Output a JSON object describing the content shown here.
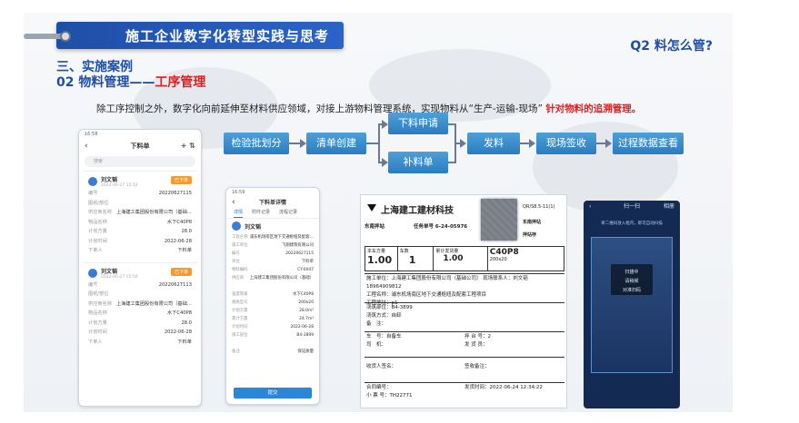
{
  "header": {
    "title": "施工企业数字化转型实践与思考",
    "question": "Q2 料怎么管?"
  },
  "section": {
    "line1": "三、实施案例",
    "line2_prefix": "02 物料管理——",
    "line2_highlight": "工序管理"
  },
  "intro": {
    "text": "除工序控制之外，数字化向前延伸至材料供应领域，对接上游物料管理系统，实现物料从“生产-运输-现场”",
    "highlight": "针对物料的追溯管理。"
  },
  "flow": {
    "steps": [
      "检验批划分",
      "清单创建",
      "下料申请",
      "补料单",
      "发料",
      "现场签收",
      "过程数据查看"
    ]
  },
  "phone1": {
    "status": "16:58",
    "title": "下料单",
    "search_placeholder": "搜索",
    "cards": [
      {
        "name": "刘文韬",
        "time": "2022-06-27 15:52",
        "badge": "已下单",
        "rows": [
          {
            "k": "编号",
            "v": "20220627115"
          },
          {
            "k": "图纸/部位",
            "v": ""
          },
          {
            "k": "供应商名称",
            "v": "上海建工集团股份有限公司（基础…"
          },
          {
            "k": "物品名称",
            "v": "水下C40P8"
          },
          {
            "k": "计划方量",
            "v": "28.0"
          },
          {
            "k": "计划时间",
            "v": "2022-06-28"
          },
          {
            "k": "下单人",
            "v": "下料单"
          }
        ]
      },
      {
        "name": "刘文韬",
        "time": "2022-06-27 15:50",
        "badge": "已下单",
        "rows": [
          {
            "k": "编号",
            "v": "20220627113"
          },
          {
            "k": "图纸/部位",
            "v": ""
          },
          {
            "k": "供应商名称",
            "v": "上海建工集团股份有限公司（基础…"
          },
          {
            "k": "物品名称",
            "v": "水下C40P8"
          },
          {
            "k": "计划方量",
            "v": "28.0"
          },
          {
            "k": "计划时间",
            "v": "2022-06-28"
          },
          {
            "k": "下单人",
            "v": "下料单"
          }
        ]
      }
    ]
  },
  "phone2": {
    "status": "16:59",
    "title": "下料单详情",
    "tabs": [
      "详情",
      "附件记录",
      "流程记录"
    ],
    "user": "刘文韬",
    "rows": [
      {
        "k": "工程名称",
        "v": "浦东机场南区地下交通枢纽及配套…"
      },
      {
        "k": "施工单位",
        "v": "飞翔建筑有限公司"
      },
      {
        "k": "编号",
        "v": "20220627115"
      },
      {
        "k": "单位",
        "v": "下料单"
      },
      {
        "k": "物料编码",
        "v": "CY-0047"
      },
      {
        "k": "供应商",
        "v": "上海建工集团股份有限公司（基础）"
      },
      {
        "k": "",
        "v": ""
      },
      {
        "k": "强度等级",
        "v": "水下C40P8"
      },
      {
        "k": "规格型号",
        "v": "200x20"
      },
      {
        "k": "计划方量",
        "v": "28.0m³"
      },
      {
        "k": "累计方量",
        "v": "24.7m³"
      },
      {
        "k": "计划时间",
        "v": "2022-06-28"
      },
      {
        "k": "施工部位",
        "v": "B4-3899"
      },
      {
        "k": "",
        "v": ""
      },
      {
        "k": "备注",
        "v": "保证质量"
      }
    ],
    "button": "提交"
  },
  "document": {
    "company": "上海建工建材科技",
    "code": "QR/S8.5-11(1)",
    "station_label": "东南拌站",
    "task_no": "任务单号 6-24-05976",
    "copy1": "东南拌站",
    "copy2": "拌站存",
    "cells": [
      {
        "label": "本车方量",
        "value": "1.00"
      },
      {
        "label": "车数",
        "value": "1"
      },
      {
        "label": "累计发货量",
        "value": "1.00"
      },
      {
        "label": "C40P8",
        "value": "200x20"
      }
    ],
    "block1": [
      "施工单位：上海建工集团股份有限公司（基础公司）  现场联系人：刘文韬  18964909812",
      "工程名称：浦东机场南区地下交通枢纽及配套工程项目",
      "工程地址：p1"
    ],
    "block2": [
      "浇筑部位：B4-3899",
      "浇筑方式：自卸",
      "备　注："
    ],
    "block3": [
      "车　号：自备车",
      "司　机：",
      "拌 台 号：2",
      "发 货 员："
    ],
    "block4": [
      "收货人签名：",
      "签收备注："
    ],
    "block5": [
      "合同编号：",
      "小 票 号：TH22771",
      "发货时间：2022-06-24 12:34:22"
    ]
  },
  "camera": {
    "title": "扫一扫",
    "album": "相册",
    "hint": "将二维码放入框内，即可自动扫描",
    "msg_line1": "扫描中",
    "msg_line2": "请稍候",
    "msg_line3": "对准扫码"
  }
}
